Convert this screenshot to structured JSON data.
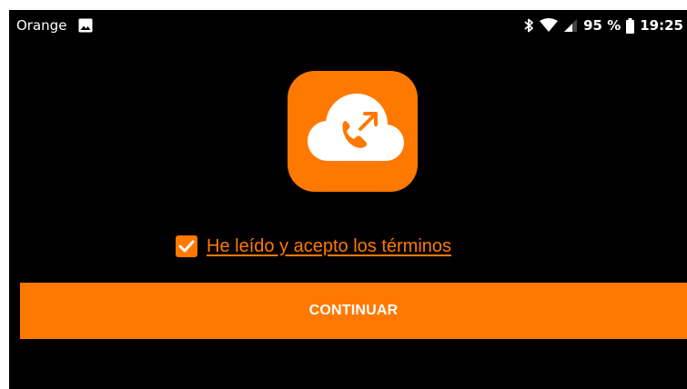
{
  "status_bar": {
    "carrier": "Orange",
    "battery": "95 %",
    "time": "19:25",
    "icons": [
      "gallery-icon",
      "bluetooth-icon",
      "wifi-icon",
      "signal-icon",
      "battery-icon"
    ]
  },
  "app": {
    "logo_icon": "cloud-phone-icon",
    "terms_checked": true,
    "terms_label": "He leído y acepto los términos",
    "continue_label": "CONTINUAR"
  },
  "colors": {
    "accent": "#ff7900",
    "background": "#000000",
    "text": "#ffffff"
  }
}
